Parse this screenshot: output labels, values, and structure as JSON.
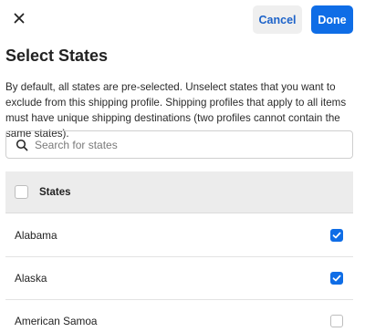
{
  "header": {
    "close_icon": "close-icon",
    "cancel_label": "Cancel",
    "done_label": "Done"
  },
  "title": "Select States",
  "description": "By default, all states are pre-selected. Unselect states that you want to exclude from this shipping profile. Shipping profiles that apply to all items must have unique shipping destinations (two profiles cannot contain the same states).",
  "search": {
    "icon": "search-icon",
    "placeholder": "Search for states",
    "value": ""
  },
  "table": {
    "header_label": "States",
    "header_checked": false,
    "rows": [
      {
        "name": "Alabama",
        "checked": true
      },
      {
        "name": "Alaska",
        "checked": true
      },
      {
        "name": "American Samoa",
        "checked": false
      }
    ]
  },
  "colors": {
    "accent": "#0f6de6",
    "cancel_text": "#1d63c9",
    "header_bg": "#ececec"
  }
}
